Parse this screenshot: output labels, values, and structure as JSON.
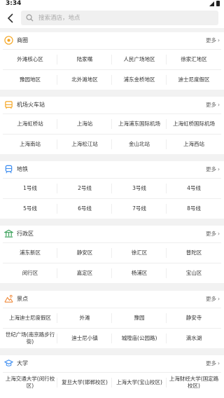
{
  "status": {
    "time": "3:34"
  },
  "search": {
    "placeholder": "搜索酒店，地点"
  },
  "more_label": "更多",
  "sections": [
    {
      "title": "商圈",
      "icon": "business-district-icon",
      "items": [
        "外滩核心区",
        "陆家嘴",
        "人民广场地区",
        "徐家汇地区",
        "豫园地区",
        "北外滩地区",
        "浦东金桥地区",
        "迪士尼度假区"
      ]
    },
    {
      "title": "机场火车站",
      "icon": "airport-train-icon",
      "items": [
        "上海虹桥站",
        "上海站",
        "上海浦东国际机场",
        "上海虹桥国际机场",
        "上海南站",
        "上海松江站",
        "金山北站",
        "上海西站"
      ]
    },
    {
      "title": "地铁",
      "icon": "metro-icon",
      "items": [
        "1号线",
        "2号线",
        "3号线",
        "4号线",
        "5号线",
        "6号线",
        "7号线",
        "8号线"
      ]
    },
    {
      "title": "行政区",
      "icon": "district-icon",
      "items": [
        "浦东新区",
        "静安区",
        "徐汇区",
        "普陀区",
        "闵行区",
        "嘉定区",
        "杨浦区",
        "宝山区"
      ]
    },
    {
      "title": "景点",
      "icon": "scenic-icon",
      "items": [
        "上海迪士尼度假区",
        "外滩",
        "豫园",
        "静安寺",
        "世纪广场(南京路步行街)",
        "迪士尼小镇",
        "城隍庙(公园路)",
        "滴水湖"
      ]
    },
    {
      "title": "大学",
      "icon": "university-icon",
      "items": [
        "上海交通大学(闵行校区)",
        "复旦大学(邯郸校区)",
        "上海大学(宝山校区)",
        "上海财经大学(国定路校区)"
      ]
    }
  ]
}
